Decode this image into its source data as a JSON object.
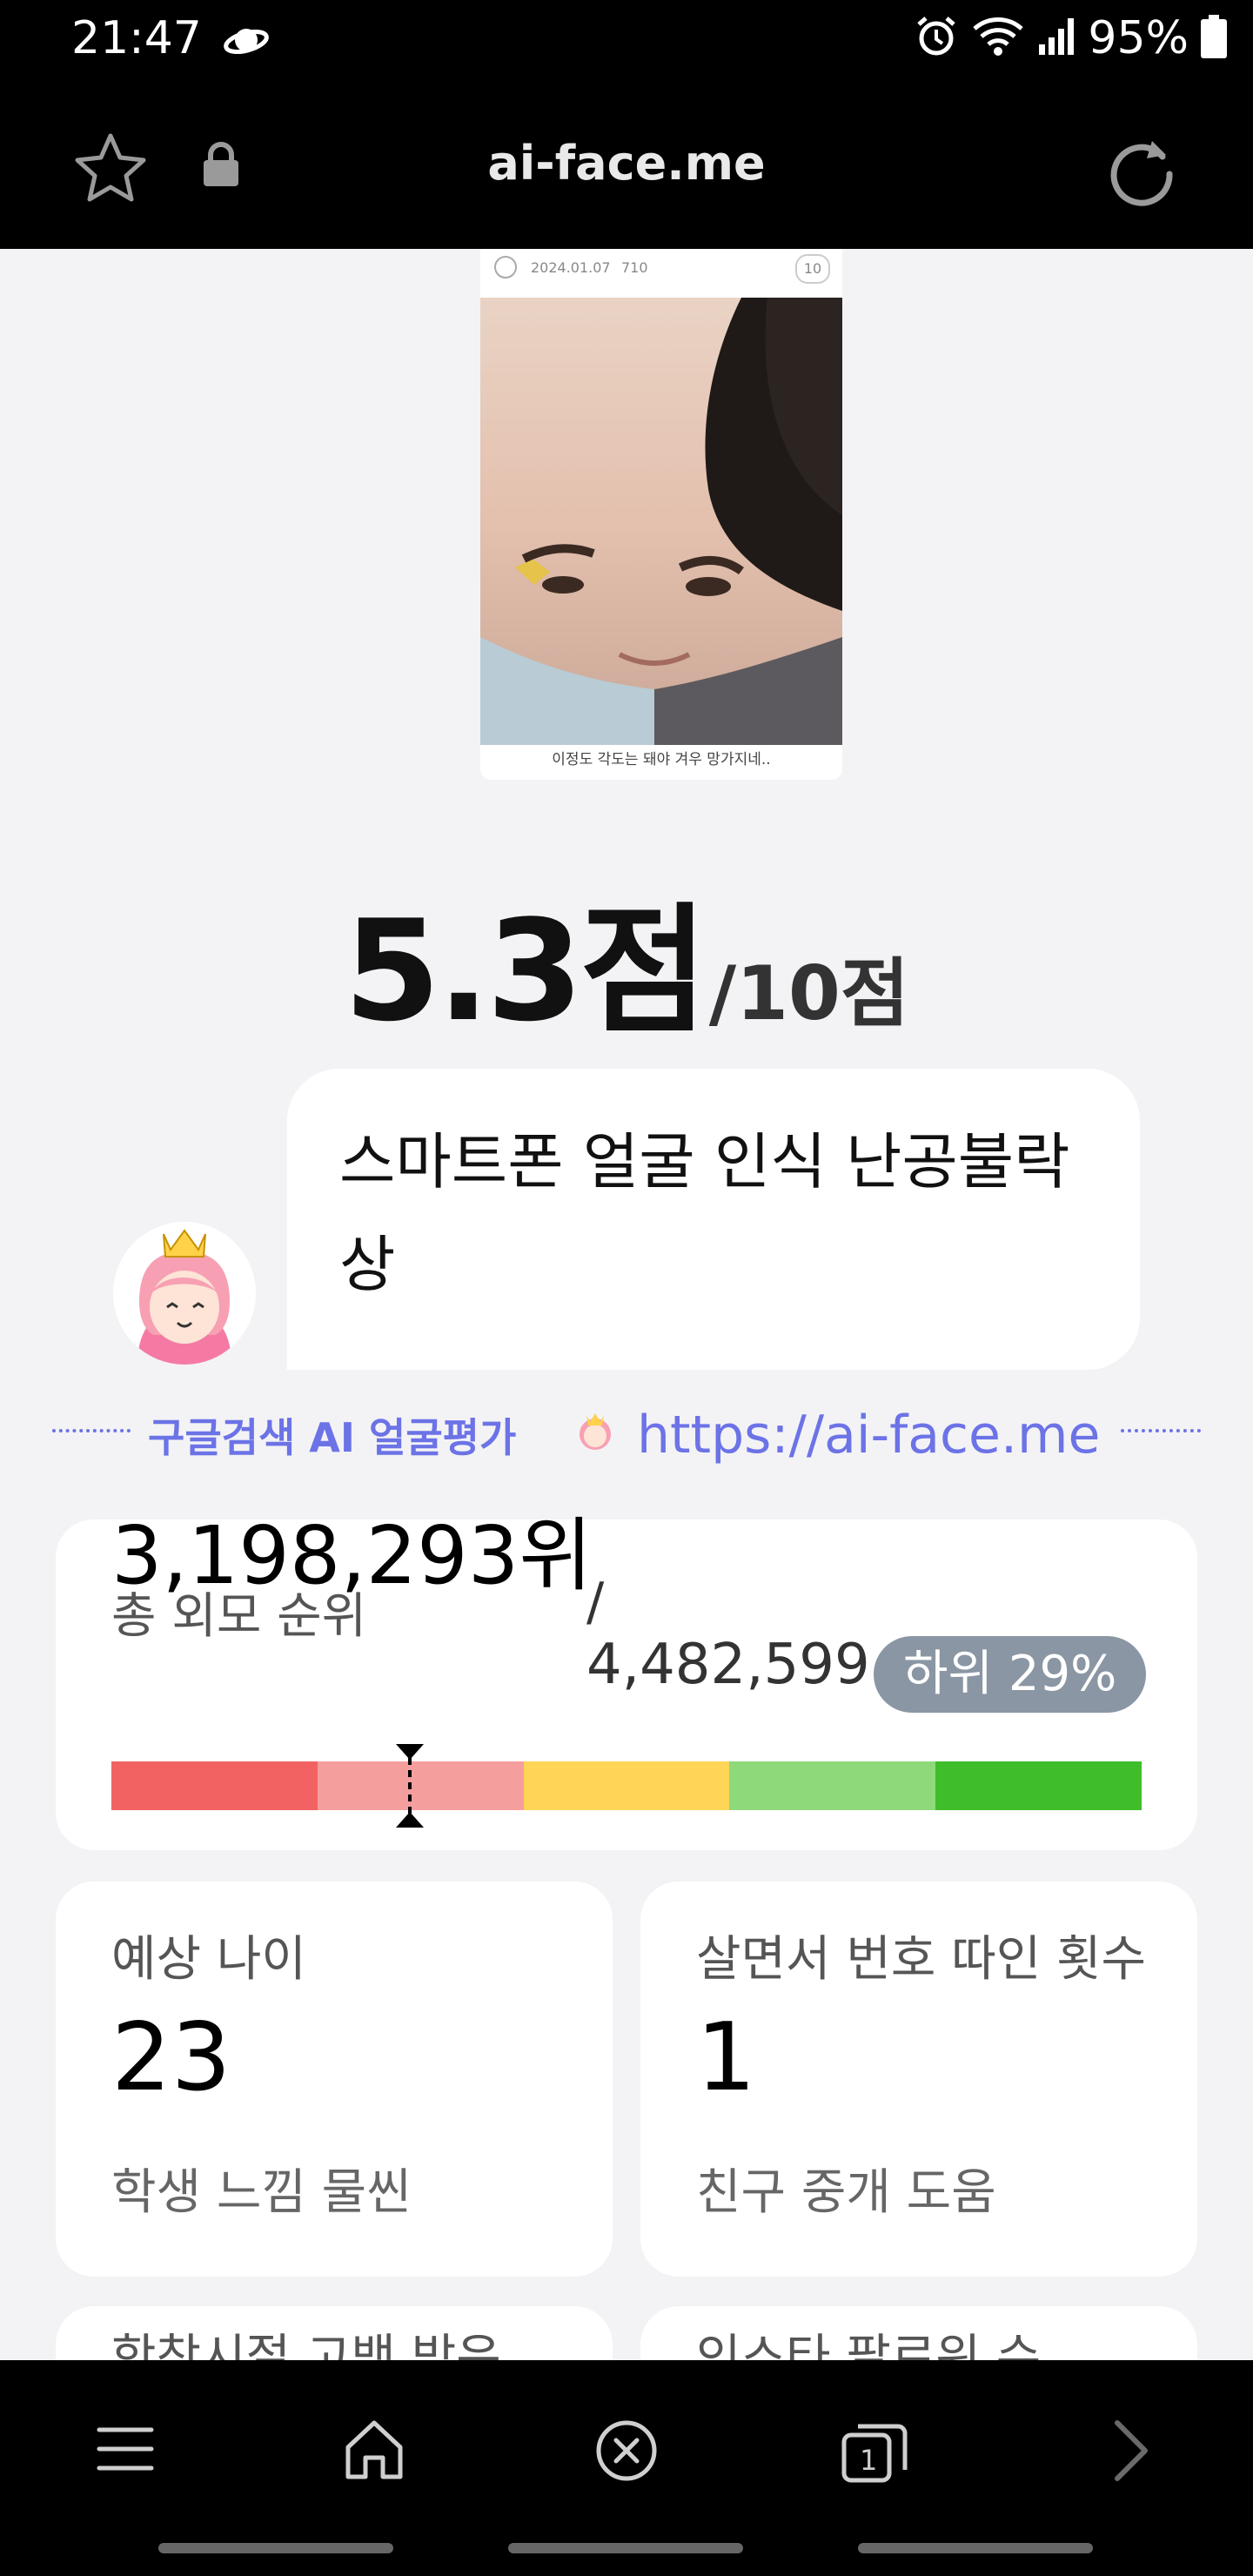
{
  "status": {
    "time": "21:47",
    "battery": "95%"
  },
  "browser": {
    "url": "ai-face.me"
  },
  "post": {
    "date": "2024.01.07",
    "views": "710",
    "comment_count": "10",
    "caption": "이정도 각도는 돼야 겨우 망가지네.."
  },
  "score": {
    "value": "5.3점",
    "max": "/10점"
  },
  "comment": {
    "text": "스마트폰 얼굴 인식 난공불락상"
  },
  "banner": {
    "label": "구글검색 AI 얼굴평가",
    "link": "https://ai-face.me"
  },
  "rank": {
    "label": "총 외모 순위",
    "value": "3,198,293위",
    "separator": "/",
    "total": "4,482,599",
    "percentile": "하위 29%",
    "position_fraction": 0.29,
    "bar_colors": [
      "#f26262",
      "#f59e9e",
      "#ffd557",
      "#8ed97a",
      "#3fbd2a"
    ]
  },
  "stats": [
    {
      "label": "예상 나이",
      "value": "23",
      "note": "학생 느낌 물씬"
    },
    {
      "label": "살면서 번호 따인 횟수",
      "value": "1",
      "note": "친구 중개 도움"
    }
  ],
  "partial_cards": [
    {
      "label": "학창시절 고백 받은"
    },
    {
      "label": "인스타 팔로워 수"
    }
  ],
  "colors": {
    "accent": "#6c73e6",
    "badge": "#8a96a3"
  }
}
